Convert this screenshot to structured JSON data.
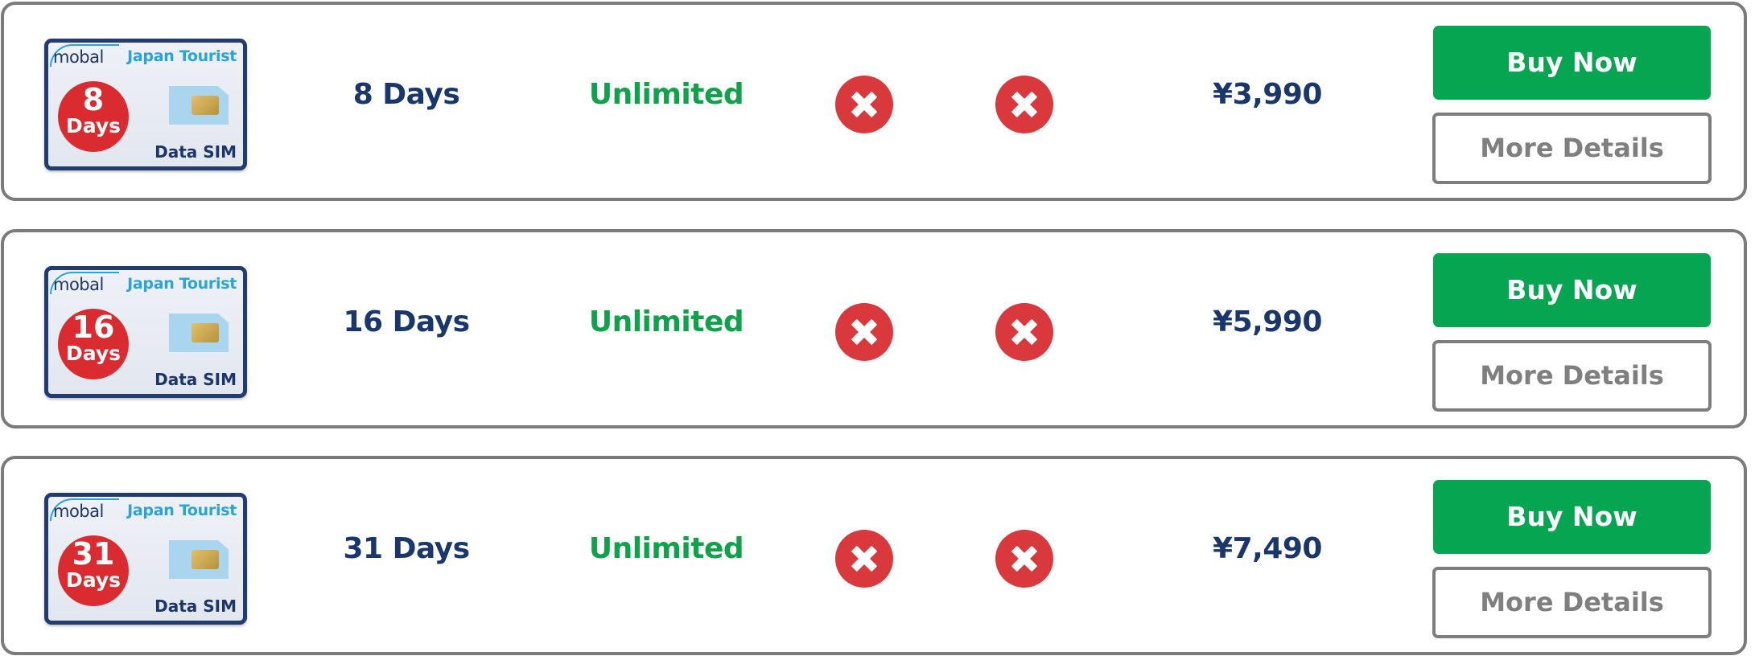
{
  "plans": [
    {
      "card": {
        "brand": "mobal",
        "product": "Japan Tourist",
        "days_number": "8",
        "days_word": "Days",
        "sim_type": "Data SIM"
      },
      "duration": "8 Days",
      "data": "Unlimited",
      "calls_icon": "x-circle-icon",
      "texts_icon": "x-circle-icon",
      "price": "¥3,990",
      "buy_label": "Buy Now",
      "details_label": "More Details"
    },
    {
      "card": {
        "brand": "mobal",
        "product": "Japan Tourist",
        "days_number": "16",
        "days_word": "Days",
        "sim_type": "Data SIM"
      },
      "duration": "16 Days",
      "data": "Unlimited",
      "calls_icon": "x-circle-icon",
      "texts_icon": "x-circle-icon",
      "price": "¥5,990",
      "buy_label": "Buy Now",
      "details_label": "More Details"
    },
    {
      "card": {
        "brand": "mobal",
        "product": "Japan Tourist",
        "days_number": "31",
        "days_word": "Days",
        "sim_type": "Data SIM"
      },
      "duration": "31 Days",
      "data": "Unlimited",
      "calls_icon": "x-circle-icon",
      "texts_icon": "x-circle-icon",
      "price": "¥7,490",
      "buy_label": "Buy Now",
      "details_label": "More Details"
    }
  ],
  "colors": {
    "primary_navy": "#1a376c",
    "unlimited_green": "#0fa24a",
    "buy_button_green": "#06a552",
    "x_icon_red": "#d9383d",
    "days_badge_red": "#da2c30",
    "brand_blue": "#29a3d8",
    "row_border_gray": "#7b7b7b",
    "details_text_gray": "#7f7f7f"
  }
}
